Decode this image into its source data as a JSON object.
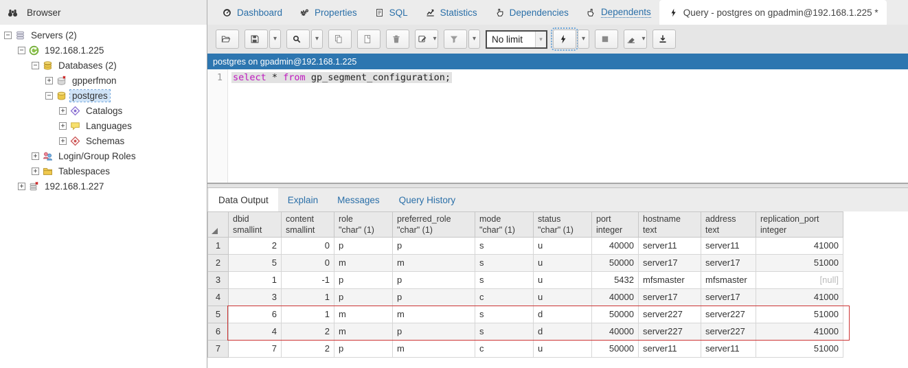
{
  "colors": {
    "accent": "#2a6fa8",
    "connection_bar_bg": "#2d76b0",
    "keyword": "#bf17bf",
    "highlight_red": "#cc3333",
    "selected_tree_bg": "#cfe3f7"
  },
  "browser": {
    "title": "Browser",
    "icon": "binoculars-icon"
  },
  "tree": {
    "items": [
      {
        "label": "Servers (2)",
        "level": 0,
        "expander": "-",
        "icon": "server-group-icon",
        "name": "servers"
      },
      {
        "label": "192.168.1.225",
        "level": 1,
        "expander": "-",
        "icon": "server-connected-icon",
        "name": "server-192-168-1-225"
      },
      {
        "label": "Databases (2)",
        "level": 2,
        "expander": "-",
        "icon": "databases-icon",
        "name": "databases"
      },
      {
        "label": "gpperfmon",
        "level": 3,
        "expander": "+",
        "icon": "database-disconnected-icon",
        "name": "db-gpperfmon"
      },
      {
        "label": "postgres",
        "level": 3,
        "expander": "-",
        "icon": "database-icon",
        "name": "db-postgres",
        "selected": true
      },
      {
        "label": "Catalogs",
        "level": 4,
        "expander": "+",
        "icon": "catalogs-icon",
        "name": "catalogs"
      },
      {
        "label": "Languages",
        "level": 4,
        "expander": "+",
        "icon": "languages-icon",
        "name": "languages"
      },
      {
        "label": "Schemas",
        "level": 4,
        "expander": "+",
        "icon": "schemas-icon",
        "name": "schemas"
      },
      {
        "label": "Login/Group Roles",
        "level": 2,
        "expander": "+",
        "icon": "login-group-roles-icon",
        "name": "login-group-roles"
      },
      {
        "label": "Tablespaces",
        "level": 2,
        "expander": "+",
        "icon": "tablespaces-icon",
        "name": "tablespaces"
      },
      {
        "label": "192.168.1.227",
        "level": 1,
        "expander": "+",
        "icon": "server-disconnected-icon",
        "name": "server-192-168-1-227"
      }
    ]
  },
  "tabs": [
    {
      "label": "Dashboard",
      "icon": "dashboard-icon"
    },
    {
      "label": "Properties",
      "icon": "properties-icon"
    },
    {
      "label": "SQL",
      "icon": "sql-icon"
    },
    {
      "label": "Statistics",
      "icon": "statistics-icon"
    },
    {
      "label": "Dependencies",
      "icon": "dependencies-icon"
    },
    {
      "label": "Dependents",
      "icon": "dependents-icon",
      "focus_dotted": true
    },
    {
      "label": "Query - postgres on gpadmin@192.168.1.225 *",
      "icon": "lightning-icon",
      "active": true
    }
  ],
  "toolbar": {
    "controls": [
      {
        "name": "open-file-button",
        "icon": "folder-open-icon"
      },
      {
        "name": "save-button",
        "icon": "save-icon",
        "caret": true
      },
      {
        "name": "find-button",
        "icon": "search-icon",
        "caret": true
      },
      {
        "name": "copy-button",
        "icon": "copy-icon"
      },
      {
        "name": "paste-button",
        "icon": "paste-icon"
      },
      {
        "name": "delete-button",
        "icon": "trash-icon"
      },
      {
        "name": "edit-button",
        "icon": "edit-icon",
        "inline_caret": true
      },
      {
        "name": "filter-button",
        "icon": "filter-icon",
        "caret": true
      },
      {
        "name": "row-limit-select",
        "type": "select",
        "value": "No limit"
      },
      {
        "name": "execute-button",
        "icon": "lightning-icon",
        "caret": true,
        "focused": true
      },
      {
        "name": "stop-button",
        "icon": "stop-icon"
      },
      {
        "name": "clear-button",
        "icon": "eraser-icon",
        "inline_caret": true
      },
      {
        "name": "download-button",
        "icon": "download-icon"
      }
    ]
  },
  "connection_bar": {
    "text": "postgres on gpadmin@192.168.1.225"
  },
  "editor": {
    "line_number": "1",
    "sql_tokens": [
      {
        "text": "select",
        "type": "keyword"
      },
      {
        "text": " * ",
        "type": "plain"
      },
      {
        "text": "from",
        "type": "keyword"
      },
      {
        "text": " gp_segment_configuration;",
        "type": "plain"
      }
    ]
  },
  "output": {
    "tabs": [
      {
        "label": "Data Output",
        "active": true
      },
      {
        "label": "Explain"
      },
      {
        "label": "Messages"
      },
      {
        "label": "Query History"
      }
    ]
  },
  "grid": {
    "corner_icon": "select-all-triangle-icon",
    "columns": [
      {
        "name": "dbid",
        "type": "smallint",
        "align": "right"
      },
      {
        "name": "content",
        "type": "smallint",
        "align": "right"
      },
      {
        "name": "role",
        "type": "\"char\" (1)",
        "align": "left"
      },
      {
        "name": "preferred_role",
        "type": "\"char\" (1)",
        "align": "left"
      },
      {
        "name": "mode",
        "type": "\"char\" (1)",
        "align": "left"
      },
      {
        "name": "status",
        "type": "\"char\" (1)",
        "align": "left"
      },
      {
        "name": "port",
        "type": "integer",
        "align": "right"
      },
      {
        "name": "hostname",
        "type": "text",
        "align": "left"
      },
      {
        "name": "address",
        "type": "text",
        "align": "left"
      },
      {
        "name": "replication_port",
        "type": "integer",
        "align": "right"
      }
    ],
    "rows": [
      [
        "2",
        "0",
        "p",
        "p",
        "s",
        "u",
        "40000",
        "server11",
        "server11",
        "41000"
      ],
      [
        "5",
        "0",
        "m",
        "m",
        "s",
        "u",
        "50000",
        "server17",
        "server17",
        "51000"
      ],
      [
        "1",
        "-1",
        "p",
        "p",
        "s",
        "u",
        "5432",
        "mfsmaster",
        "mfsmaster",
        "[null]"
      ],
      [
        "3",
        "1",
        "p",
        "p",
        "c",
        "u",
        "40000",
        "server17",
        "server17",
        "41000"
      ],
      [
        "6",
        "1",
        "m",
        "m",
        "s",
        "d",
        "50000",
        "server227",
        "server227",
        "51000"
      ],
      [
        "4",
        "2",
        "m",
        "p",
        "s",
        "d",
        "40000",
        "server227",
        "server227",
        "41000"
      ],
      [
        "7",
        "2",
        "p",
        "m",
        "c",
        "u",
        "50000",
        "server11",
        "server11",
        "51000"
      ]
    ],
    "null_display": "[null]",
    "highlight_rows": [
      5,
      6
    ]
  }
}
